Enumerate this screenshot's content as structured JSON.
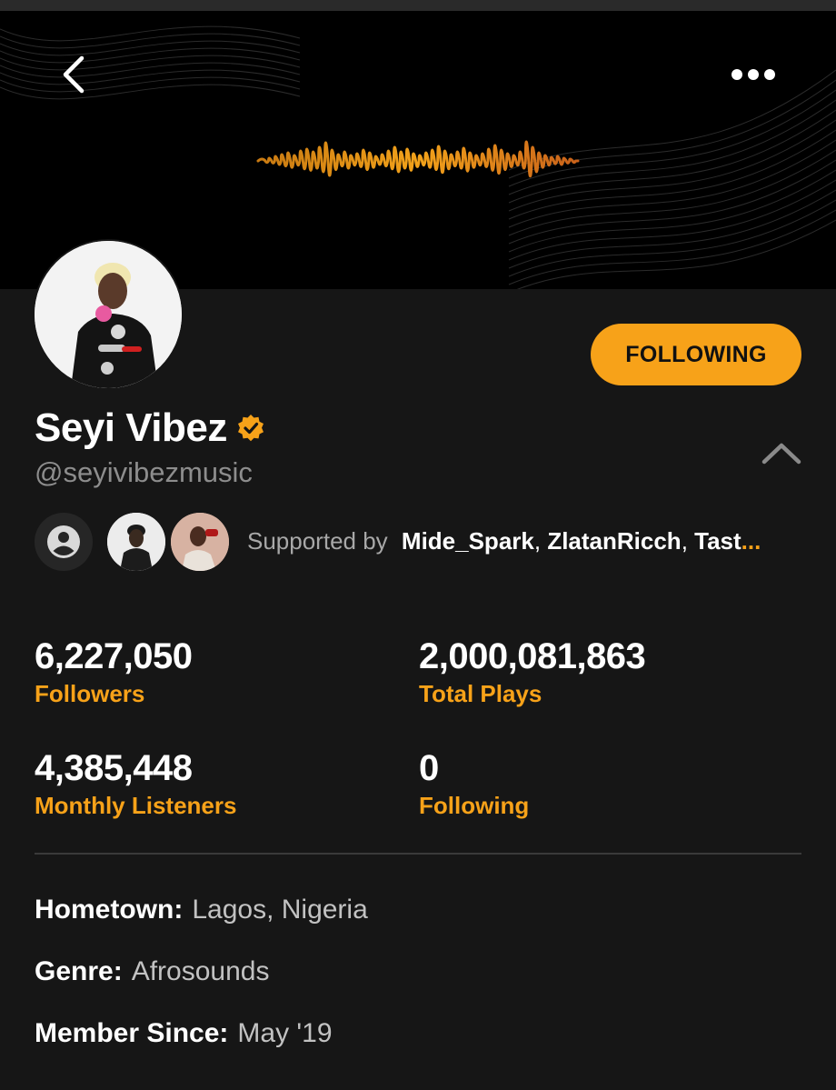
{
  "colors": {
    "accent": "#f7a219",
    "background": "#161616",
    "banner": "#000000",
    "muted": "#8d8d8d"
  },
  "header": {
    "back_icon": "chevron-left-icon",
    "more_icon": "more-horizontal-icon"
  },
  "profile": {
    "name": "Seyi Vibez",
    "verified_icon": "verified-badge-icon",
    "handle": "@seyivibezmusic",
    "follow_button_label": "FOLLOWING",
    "collapse_icon": "chevron-up-icon"
  },
  "supporters": {
    "label": "Supported by",
    "names": [
      "Mide_Spark",
      "ZlatanRicch",
      "Tast"
    ],
    "separator": ", ",
    "more": "..."
  },
  "stats": [
    {
      "value": "6,227,050",
      "label": "Followers"
    },
    {
      "value": "2,000,081,863",
      "label": "Total Plays"
    },
    {
      "value": "4,385,448",
      "label": "Monthly Listeners"
    },
    {
      "value": "0",
      "label": "Following"
    }
  ],
  "info": [
    {
      "label": "Hometown:",
      "value": "Lagos, Nigeria"
    },
    {
      "label": "Genre:",
      "value": "Afrosounds"
    },
    {
      "label": "Member Since:",
      "value": "May '19"
    }
  ]
}
